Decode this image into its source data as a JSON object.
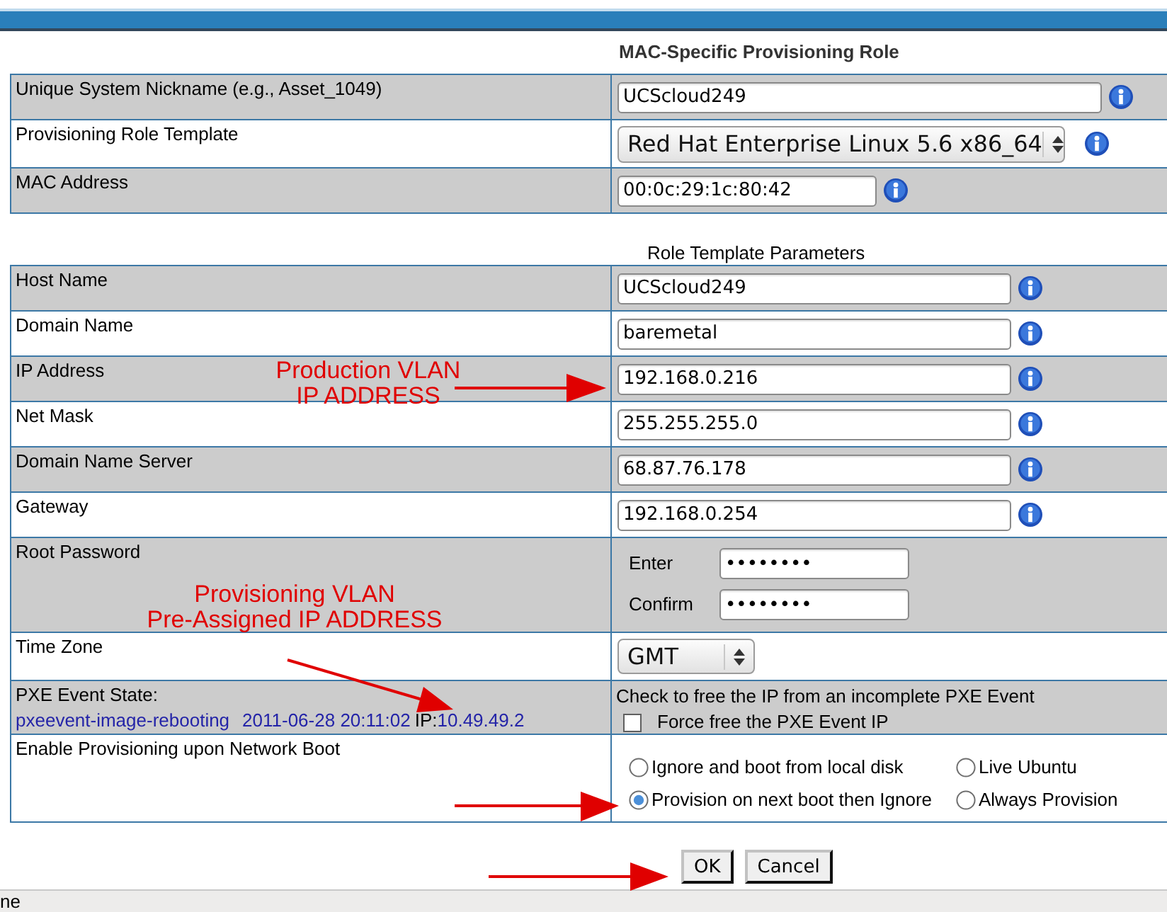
{
  "mac_role": {
    "title": "MAC-Specific Provisioning Role",
    "rows": [
      {
        "label": "Unique System Nickname (e.g., Asset_1049)",
        "kind": "text",
        "value": "UCScloud249",
        "info": true
      },
      {
        "label": "Provisioning Role Template",
        "kind": "select",
        "value": "Red Hat Enterprise Linux 5.6 x86_64",
        "info": true
      },
      {
        "label": "MAC Address",
        "kind": "text",
        "value": "00:0c:29:1c:80:42",
        "info": true
      }
    ]
  },
  "parameters": {
    "title": "Role Template Parameters",
    "rows": [
      {
        "label": "Host Name",
        "kind": "text",
        "value": "UCScloud249",
        "info": true
      },
      {
        "label": "Domain Name",
        "kind": "text",
        "value": "baremetal",
        "info": true
      },
      {
        "label": "IP Address",
        "kind": "text",
        "value": "192.168.0.216",
        "info": true
      },
      {
        "label": "Net Mask",
        "kind": "text",
        "value": "255.255.255.0",
        "info": true
      },
      {
        "label": "Domain Name Server",
        "kind": "text",
        "value": "68.87.76.178",
        "info": true
      },
      {
        "label": "Gateway",
        "kind": "text",
        "value": "192.168.0.254",
        "info": true
      },
      {
        "label": "Root Password",
        "kind": "password",
        "info": false,
        "fields": [
          {
            "label": "Enter",
            "value": "••••••••"
          },
          {
            "label": "Confirm",
            "value": "••••••••"
          }
        ]
      },
      {
        "label": "Time Zone",
        "kind": "select",
        "value": "GMT",
        "info": false
      },
      {
        "label": "PXE Event State:",
        "kind": "pxe",
        "info": false,
        "event": "pxeevent-image-rebooting",
        "timestamp": "2011-06-28 20:11:02",
        "ip_label": "IP:",
        "ip": "10.49.49.2",
        "note": "Check to free the IP from an incomplete PXE Event",
        "checkbox": {
          "label": "Force free the PXE Event IP",
          "checked": false
        }
      },
      {
        "label": "Enable Provisioning upon Network Boot",
        "kind": "radio",
        "info": false,
        "options": [
          {
            "label": "Ignore and boot from local disk",
            "selected": false
          },
          {
            "label": "Live Ubuntu",
            "selected": false
          },
          {
            "label": "Provision on next boot then Ignore",
            "selected": true
          },
          {
            "label": "Always Provision",
            "selected": false
          }
        ]
      }
    ]
  },
  "annotations": [
    {
      "lines": [
        "Production VLAN",
        "IP ADDRESS"
      ]
    },
    {
      "lines": [
        "Provisioning VLAN",
        "Pre-Assigned IP ADDRESS"
      ]
    }
  ],
  "buttons": [
    {
      "label": "OK"
    },
    {
      "label": "Cancel"
    }
  ],
  "status_bar": {
    "text": "ne"
  }
}
